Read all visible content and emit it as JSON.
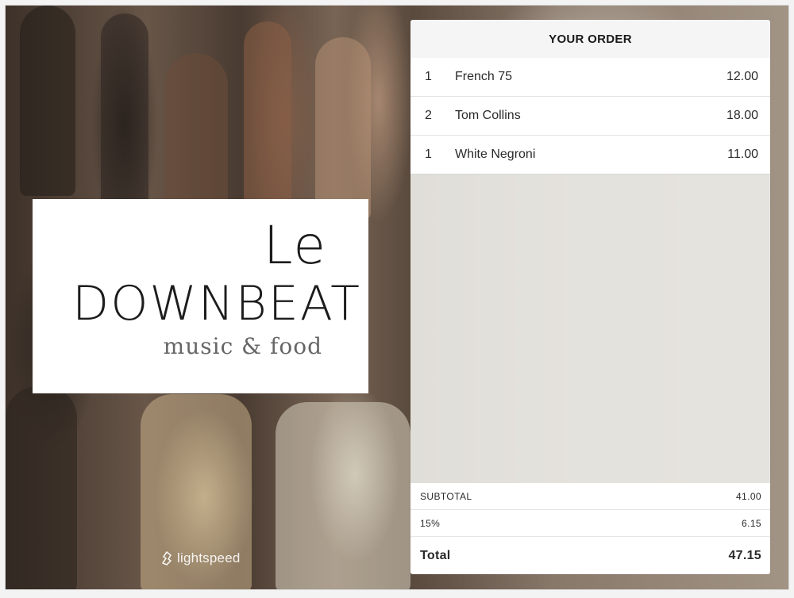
{
  "logo": {
    "line1": "Le",
    "line2": "Downbeat",
    "tagline": "music & food"
  },
  "brand": {
    "name": "lightspeed",
    "icon": "lightspeed-flame-icon"
  },
  "order": {
    "header": "YOUR ORDER",
    "items": [
      {
        "qty": "1",
        "name": "French 75",
        "price": "12.00"
      },
      {
        "qty": "2",
        "name": "Tom Collins",
        "price": "18.00"
      },
      {
        "qty": "1",
        "name": "White Negroni",
        "price": "11.00"
      }
    ],
    "subtotal_label": "SUBTOTAL",
    "subtotal_value": "41.00",
    "tax_label": "15%",
    "tax_value": "6.15",
    "total_label": "Total",
    "total_value": "47.15"
  },
  "colors": {
    "panel_bg": "#ebe9e5",
    "text": "#2a2a2a"
  }
}
